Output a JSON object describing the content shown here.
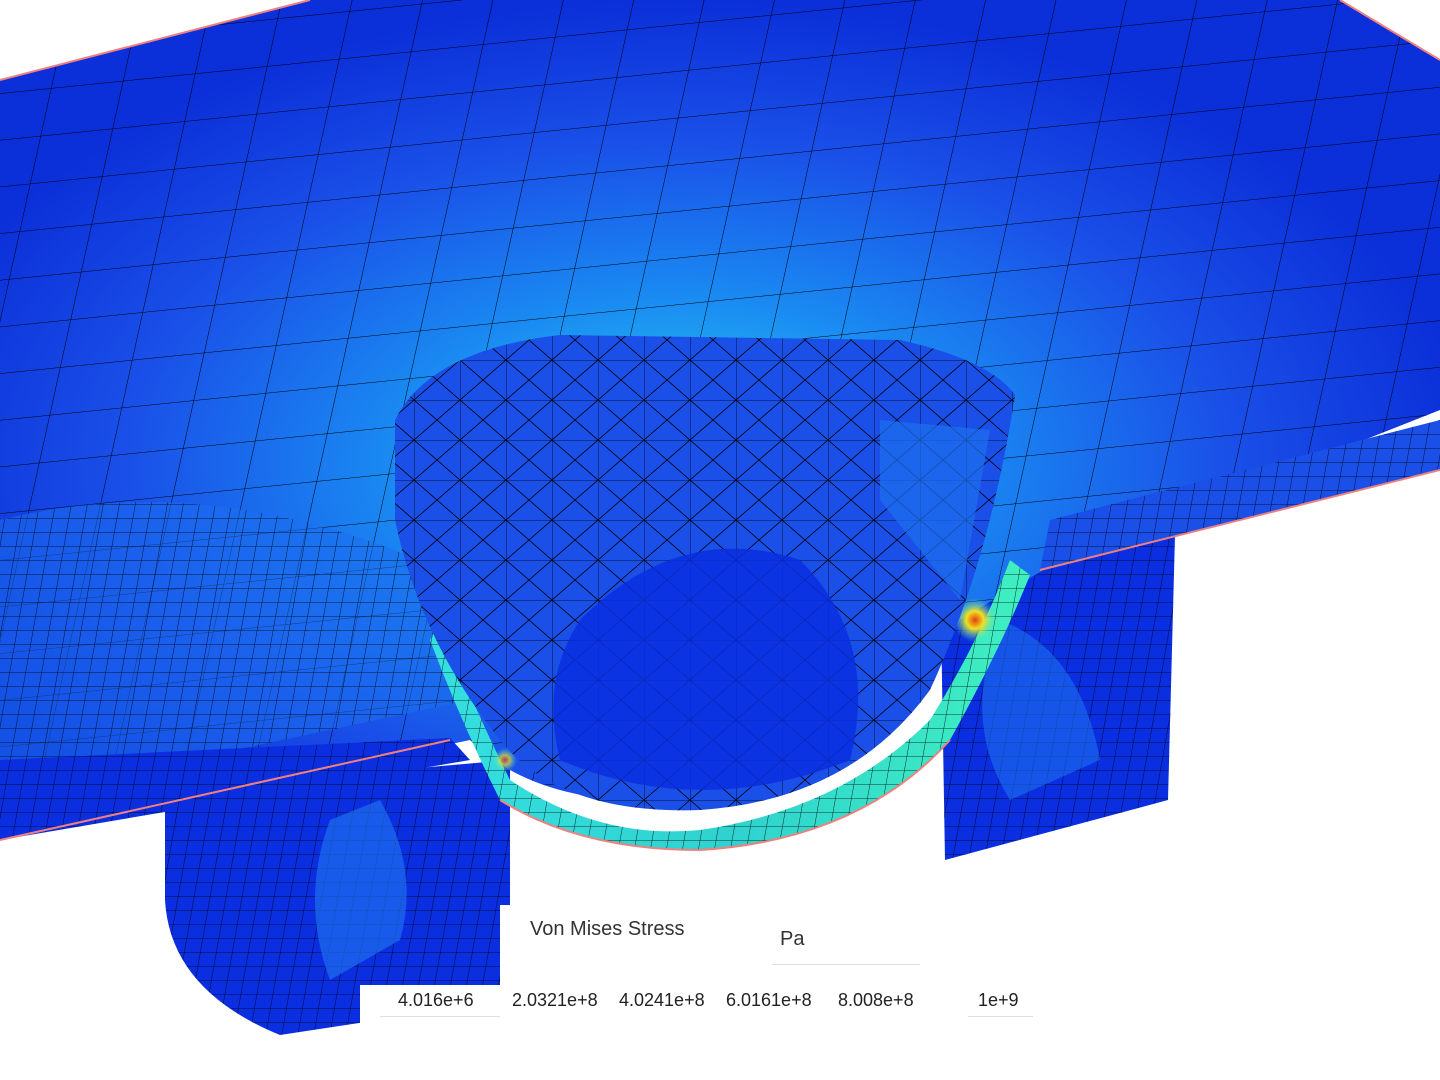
{
  "legend": {
    "title": "Von Mises Stress",
    "unit": "Pa",
    "ticks": [
      "4.016e+6",
      "2.0321e+8",
      "4.0241e+8",
      "6.0161e+8",
      "8.008e+8",
      "1e+9"
    ]
  },
  "colors": {
    "low": "#0a2ee0",
    "mid_low": "#1e6ff0",
    "mid": "#35b6f5",
    "mid_high": "#3fe8d8",
    "high": "#f2e020",
    "peak": "#e04010",
    "mesh_line": "#000000",
    "edge_highlight": "#f08080"
  }
}
